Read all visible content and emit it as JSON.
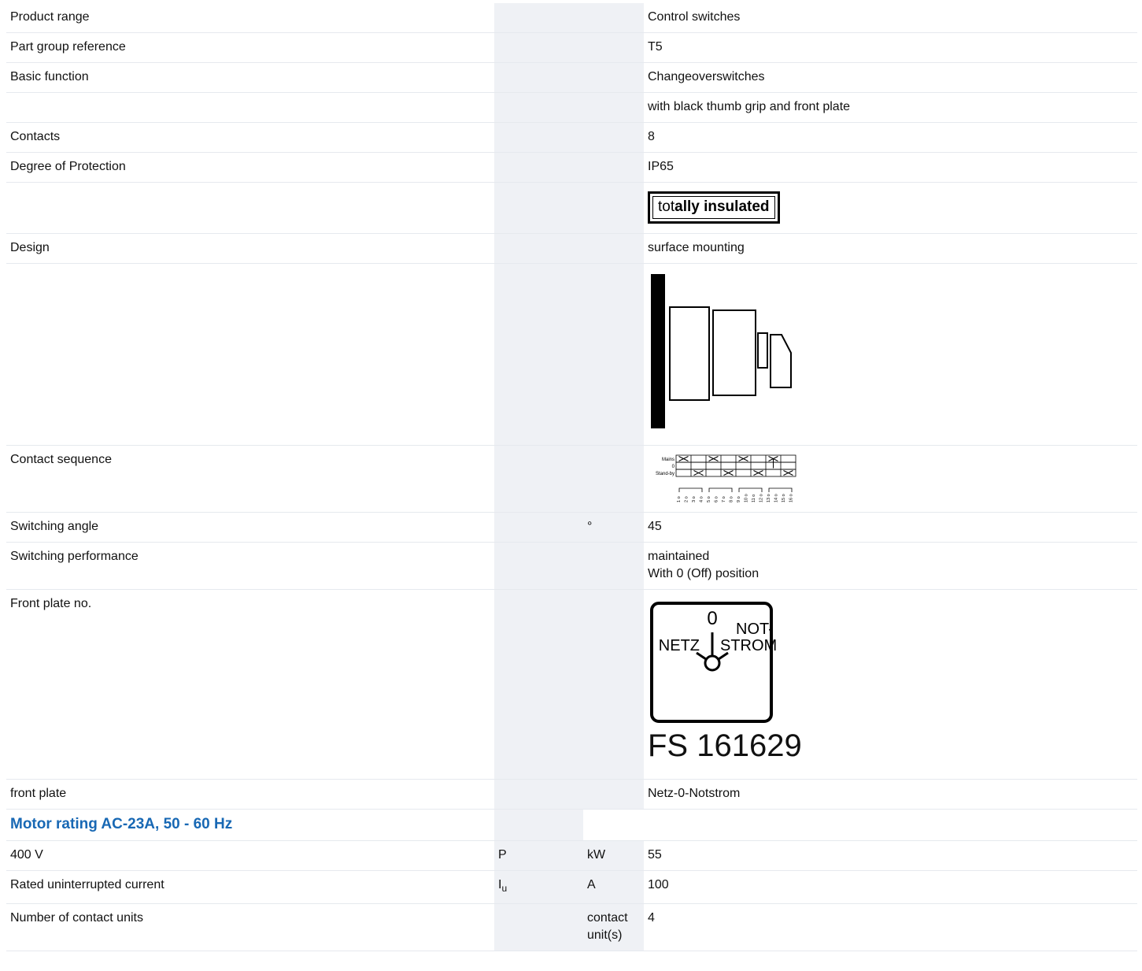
{
  "rows": {
    "product_range": {
      "label": "Product range",
      "value": "Control switches"
    },
    "part_group": {
      "label": "Part group reference",
      "value": "T5"
    },
    "basic_function": {
      "label": "Basic function",
      "value": "Changeoverswitches"
    },
    "basic_function_extra": {
      "value": "with black thumb grip and front plate"
    },
    "contacts": {
      "label": "Contacts",
      "value": "8"
    },
    "protection": {
      "label": "Degree of Protection",
      "value": "IP65"
    },
    "insulation_badge": {
      "text_light": "tot",
      "text_bold_mid": "ally",
      "text_light2": " ",
      "text_bold": "insulated"
    },
    "design": {
      "label": "Design",
      "value": "surface mounting"
    },
    "contact_sequence": {
      "label": "Contact sequence",
      "positions": [
        "Mains",
        "0",
        "Stand-by"
      ],
      "terminals": [
        "1",
        "2",
        "3",
        "4",
        "5",
        "6",
        "7",
        "8",
        "9",
        "10",
        "11",
        "12",
        "13",
        "14",
        "15",
        "16"
      ]
    },
    "switching_angle": {
      "label": "Switching angle",
      "unit": "°",
      "value": "45"
    },
    "switching_performance": {
      "label": "Switching performance",
      "value_line1": "maintained",
      "value_line2": "With 0 (Off) position"
    },
    "front_plate_no": {
      "label": "Front plate no.",
      "plate_left": "NETZ",
      "plate_center": "0",
      "plate_right_top": "NOT-",
      "plate_right_bottom": "STROM",
      "plate_code": "FS 161629"
    },
    "front_plate": {
      "label": "front plate",
      "value": "Netz-0-Notstrom"
    }
  },
  "section": {
    "title": "Motor rating AC-23A, 50 - 60 Hz"
  },
  "rating_rows": {
    "v400": {
      "label": "400 V",
      "symbol": "P",
      "unit": "kW",
      "value": "55"
    },
    "iu": {
      "label": "Rated uninterrupted current",
      "symbol": "I",
      "symbol_sub": "u",
      "unit": "A",
      "value": "100"
    },
    "contact_units": {
      "label": "Number of contact units",
      "unit": "contact unit(s)",
      "value": "4"
    }
  }
}
